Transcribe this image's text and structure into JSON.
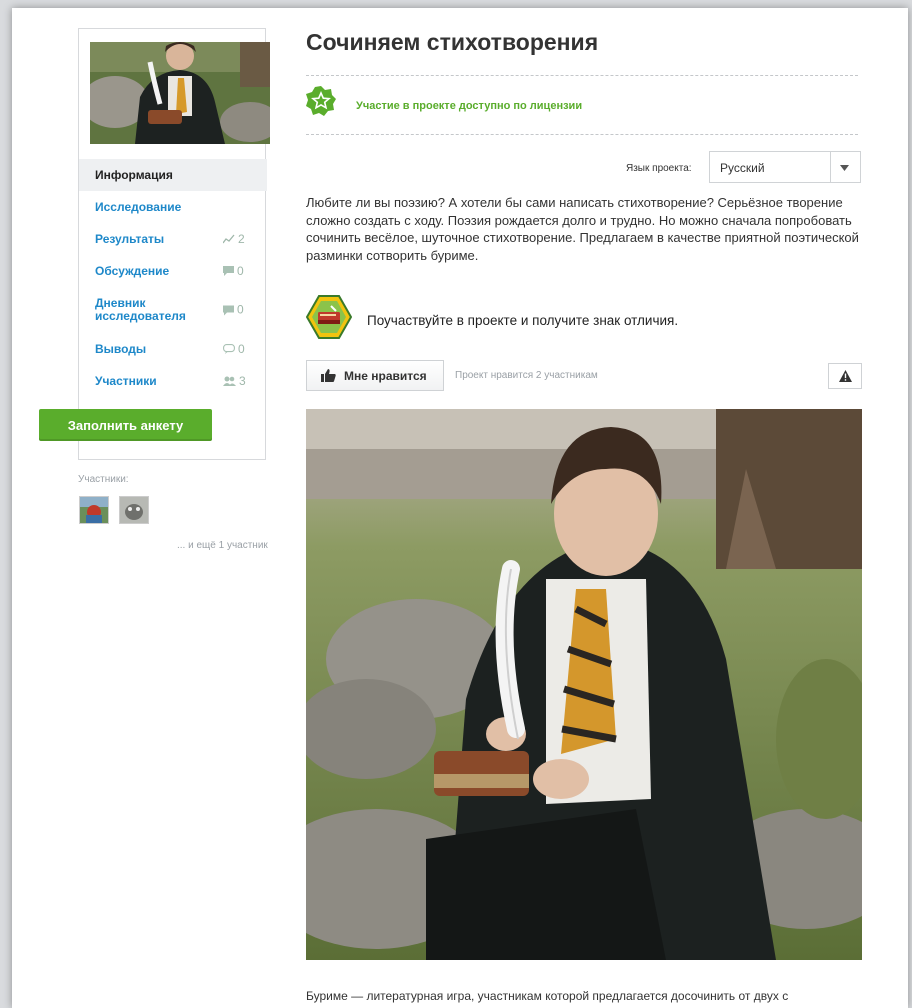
{
  "project": {
    "title": "Сочиняем стихотворения",
    "license_notice": "Участие в проекте доступно по лицензии",
    "language_label": "Язык проекта:",
    "language_value": "Русский",
    "description": "Любите ли вы поэзию? А хотели бы сами написать стихотворение? Серьёзное творение сложно создать с ходу. Поэзия рождается долго и трудно. Но можно сначала попробовать сочинить весёлое, шуточное стихотворение. Предлагаем в качестве приятной поэтической разминки сотворить буриме.",
    "badge_text": "Поучаствуйте в проекте и получите знак отличия.",
    "like_label": "Мне нравится",
    "like_count_text": "Проект нравится 2 участникам",
    "bottom_text": "Буриме — литературная игра, участникам которой предлагается досочинить от двух с"
  },
  "sidebar": {
    "items": [
      {
        "label": "Информация",
        "count": ""
      },
      {
        "label": "Исследование",
        "count": ""
      },
      {
        "label": "Результаты",
        "count": "2"
      },
      {
        "label": "Обсуждение",
        "count": "0"
      },
      {
        "label": "Дневник исследователя",
        "count": "0"
      },
      {
        "label": "Выводы",
        "count": "0"
      },
      {
        "label": "Участники",
        "count": "3"
      }
    ],
    "fill_button": "Заполнить анкету",
    "members_label": "Участники:",
    "more_members": "... и ещё 1 участник"
  },
  "colors": {
    "link": "#1e88c9",
    "accent_green": "#5aad2c",
    "text": "#333333"
  }
}
